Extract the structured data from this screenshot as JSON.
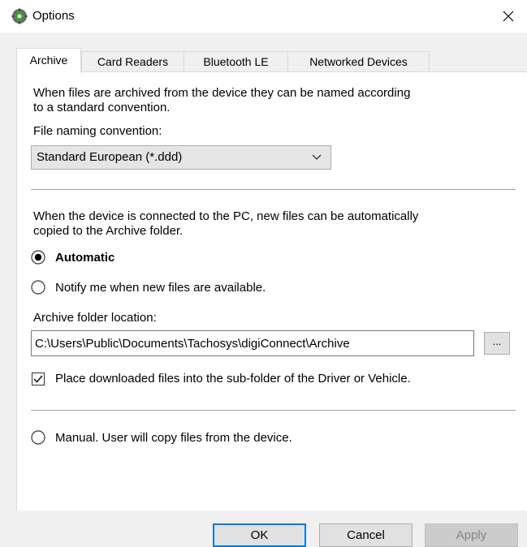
{
  "window": {
    "title": "Options",
    "icon": "digiconnect-app-icon",
    "close_icon": "close-icon"
  },
  "tabs": [
    {
      "label": "Archive",
      "active": true
    },
    {
      "label": "Card Readers",
      "active": false
    },
    {
      "label": "Bluetooth LE",
      "active": false
    },
    {
      "label": "Networked Devices",
      "active": false
    }
  ],
  "archive": {
    "intro_line1": "When files are archived from the device they can be named according",
    "intro_line2": "to a standard convention.",
    "naming_label": "File naming convention:",
    "naming_value": "Standard European (*.ddd)",
    "auto_text_line1": "When the device is connected to the PC, new files can be automatically",
    "auto_text_line2": "copied to the Archive folder.",
    "radio_automatic": "Automatic",
    "radio_automatic_selected": true,
    "radio_notify": "Notify me when new files are available.",
    "radio_notify_selected": false,
    "folder_label": "Archive folder location:",
    "folder_value": "C:\\Users\\Public\\Documents\\Tachosys\\digiConnect\\Archive",
    "browse_label": "...",
    "subfolder_checkbox": "Place downloaded files into the sub-folder of the Driver or Vehicle.",
    "subfolder_checked": true,
    "radio_manual": "Manual.  User will copy files from the device.",
    "radio_manual_selected": false
  },
  "buttons": {
    "ok": "OK",
    "cancel": "Cancel",
    "apply": "Apply"
  },
  "colors": {
    "accent": "#0078d7",
    "window_bg": "#f0f0f0",
    "panel_bg": "#ffffff"
  }
}
